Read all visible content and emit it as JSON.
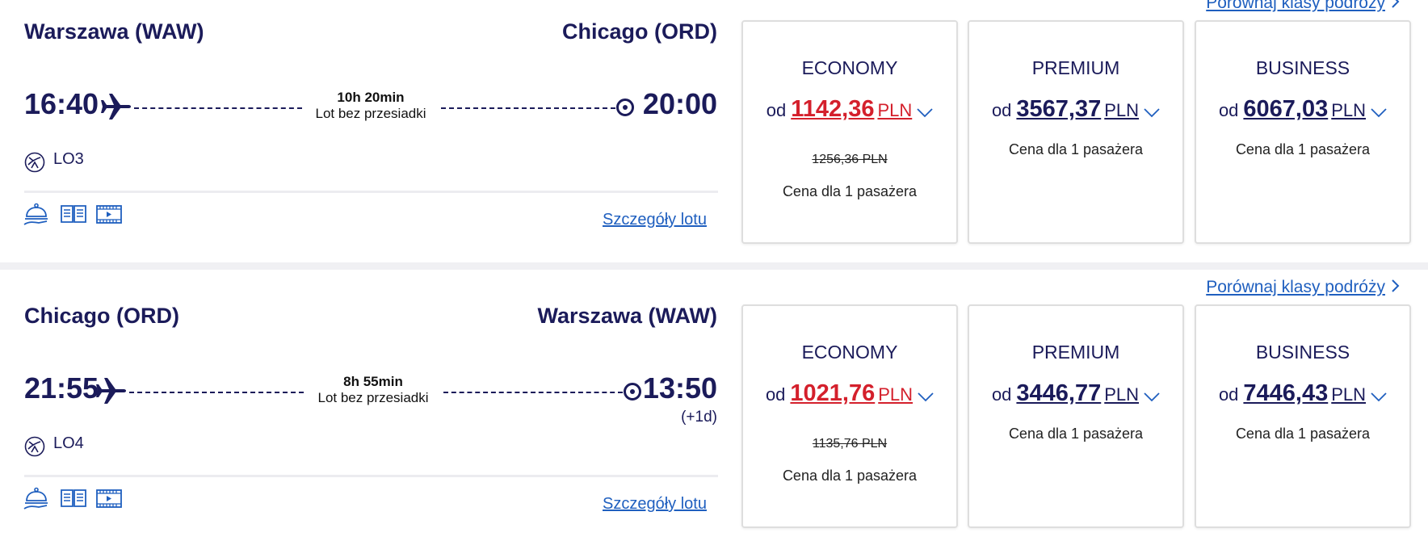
{
  "colors": {
    "navy": "#1b1b5a",
    "link_blue": "#1f5fbf",
    "promo_red": "#d4202c",
    "card_border": "#dedede",
    "row_separator": "#f0f0f3"
  },
  "flights": [
    {
      "compare_link": "Porównaj klasy podróży",
      "from_city": "Warszawa (WAW)",
      "to_city": "Chicago (ORD)",
      "depart_time": "16:40",
      "arrive_time": "20:00",
      "arrive_plus_day": "",
      "duration": "10h 20min",
      "stops": "Lot bez przesiadki",
      "airline_icon": "lot-crane-logo-icon",
      "flight_number": "LO3",
      "amenities": [
        "meal-cloche-icon",
        "book-reading-icon",
        "video-entertainment-icon"
      ],
      "details_link": "Szczegóły lotu",
      "fares": [
        {
          "class": "ECONOMY",
          "prefix": "od",
          "amount": "1142,36",
          "currency": "PLN",
          "old_price": "1256,36 PLN",
          "note": "Cena dla 1 pasażera",
          "promo": true
        },
        {
          "class": "PREMIUM",
          "prefix": "od",
          "amount": "3567,37",
          "currency": "PLN",
          "old_price": "",
          "note": "Cena dla 1 pasażera",
          "promo": false
        },
        {
          "class": "BUSINESS",
          "prefix": "od",
          "amount": "6067,03",
          "currency": "PLN",
          "old_price": "",
          "note": "Cena dla 1 pasażera",
          "promo": false
        }
      ]
    },
    {
      "compare_link": "Porównaj klasy podróży",
      "from_city": "Chicago (ORD)",
      "to_city": "Warszawa (WAW)",
      "depart_time": "21:55",
      "arrive_time": "13:50",
      "arrive_plus_day": "(+1d)",
      "duration": "8h 55min",
      "stops": "Lot bez przesiadki",
      "airline_icon": "lot-crane-logo-icon",
      "flight_number": "LO4",
      "amenities": [
        "meal-cloche-icon",
        "book-reading-icon",
        "video-entertainment-icon"
      ],
      "details_link": "Szczegóły lotu",
      "fares": [
        {
          "class": "ECONOMY",
          "prefix": "od",
          "amount": "1021,76",
          "currency": "PLN",
          "old_price": "1135,76 PLN",
          "note": "Cena dla 1 pasażera",
          "promo": true
        },
        {
          "class": "PREMIUM",
          "prefix": "od",
          "amount": "3446,77",
          "currency": "PLN",
          "old_price": "",
          "note": "Cena dla 1 pasażera",
          "promo": false
        },
        {
          "class": "BUSINESS",
          "prefix": "od",
          "amount": "7446,43",
          "currency": "PLN",
          "old_price": "",
          "note": "Cena dla 1 pasażera",
          "promo": false
        }
      ]
    }
  ]
}
